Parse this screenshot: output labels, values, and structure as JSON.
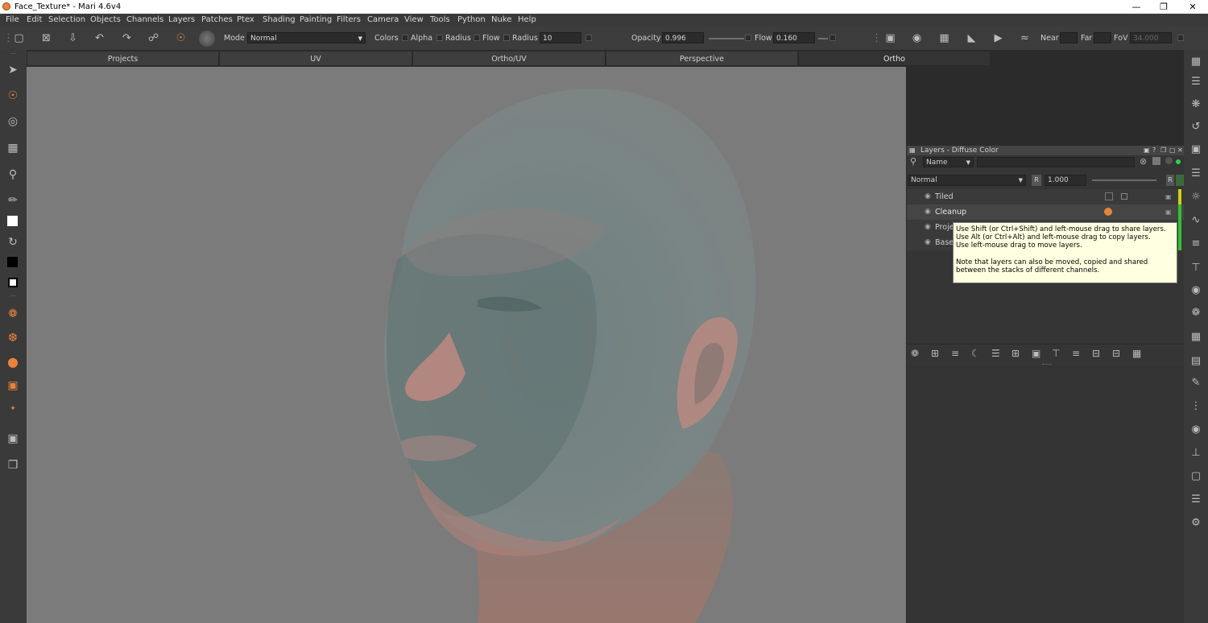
{
  "window": {
    "title": "Face_Texture* - Mari 4.6v4"
  },
  "menu": [
    "File",
    "Edit",
    "Selection",
    "Objects",
    "Channels",
    "Layers",
    "Patches",
    "Ptex",
    "Shading",
    "Painting",
    "Filters",
    "Camera",
    "View",
    "Tools",
    "Python",
    "Nuke",
    "Help"
  ],
  "toolbar": {
    "mode_label": "Mode",
    "mode_value": "Normal",
    "colors_label": "Colors",
    "alpha_label": "Alpha",
    "radius_label_1": "Radius",
    "flow_label_1": "Flow",
    "radius_label_2": "Radius",
    "radius_value": "10",
    "opacity_label": "Opacity",
    "opacity_value": "0.996",
    "flow_label_2": "Flow",
    "flow_value": "0.160",
    "near_label": "Near",
    "far_label": "Far",
    "fov_label": "FoV",
    "fov_value": "34.000"
  },
  "view_tabs": [
    "Projects",
    "UV",
    "Ortho/UV",
    "Perspective",
    "Ortho"
  ],
  "active_tab": "Ortho",
  "layers_panel": {
    "title": "Layers - Diffuse Color",
    "filter_value": "Name",
    "blend_mode": "Normal",
    "opacity_value": "1.000",
    "r_label": "R",
    "layers": [
      {
        "name": "Tiled"
      },
      {
        "name": "Cleanup"
      },
      {
        "name": "Proje"
      },
      {
        "name": "Base"
      }
    ],
    "tooltip": {
      "line1": "Use Shift (or Ctrl+Shift) and left-mouse drag to share layers.",
      "line2": "Use Alt (or Ctrl+Alt) and left-mouse drag to copy layers.",
      "line3": "Use left-mouse drag to move layers.",
      "line4": "Note that layers can also be moved, copied and shared",
      "line5": "between the stacks of different channels."
    }
  },
  "colors": {
    "accent": "#e8833a",
    "viewport_bg": "#7b7b7b",
    "tooltip_bg": "#ffffe1",
    "status_green": "#2bd24a"
  },
  "icons": {
    "left": [
      "select-icon",
      "paint-icon",
      "clone-icon",
      "grid-icon",
      "zoom-icon",
      "eyedropper-icon",
      "white-swatch-icon",
      "swap-icon",
      "black-swatch-icon",
      "swatch-pair-icon",
      "paint-buffer-icon",
      "brush-icon",
      "dot-icon",
      "marquee-icon",
      "transform-icon",
      "frame-icon",
      "frame2-icon"
    ],
    "right": [
      "panel-icon",
      "menu-lines-icon",
      "asterisk-icon",
      "history-icon",
      "image-icon",
      "list-icon",
      "light-icon",
      "curve-icon",
      "tree-icon",
      "nodes-icon",
      "shader-icon",
      "palette-icon",
      "grid-icon",
      "toggle-icon",
      "script-icon",
      "stack-icon",
      "camera-icon",
      "graph-icon",
      "rect-icon",
      "layers-icon",
      "tools-icon"
    ]
  }
}
